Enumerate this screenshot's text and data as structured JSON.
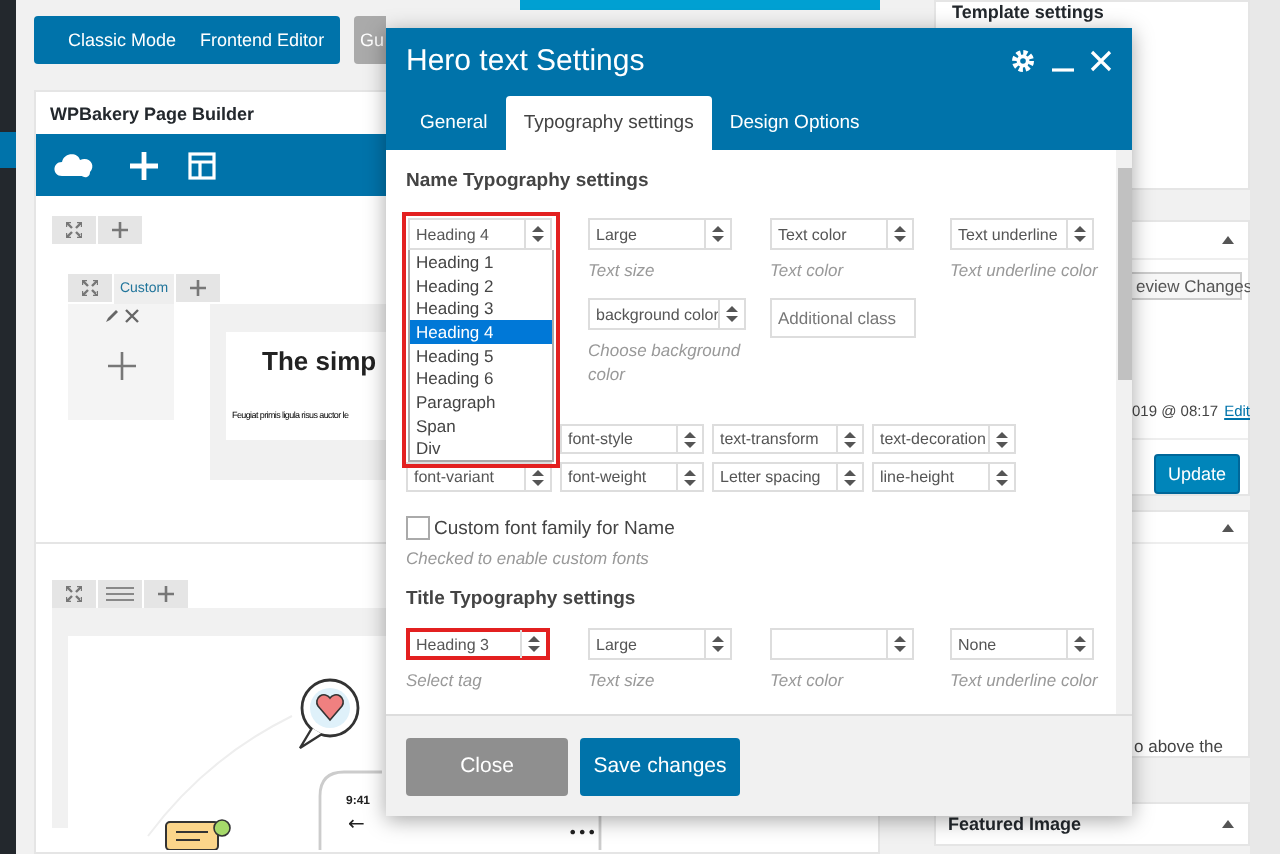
{
  "topbar": {
    "mode_buttons": [
      {
        "label": "Classic Mode"
      },
      {
        "label": "Frontend Editor"
      }
    ],
    "guide_button": "Gu"
  },
  "builder": {
    "title": "WPBakery Page Builder",
    "column_label": "Custom",
    "heading": "The simp",
    "paragraph": "Feugiat primis ligula risus auctor le",
    "phone_time": "9:41",
    "phone_back": "←",
    "phone_menu": "•••"
  },
  "sidebar": {
    "template_title": "Template settings",
    "preview_button": "eview Changes",
    "date": "019 @ 08:17",
    "edit_link": "Edit",
    "update_button": "Update",
    "note": "o above the",
    "featured_title": "Featured Image"
  },
  "modal": {
    "title": "Hero text Settings",
    "tabs": [
      {
        "label": "General",
        "selected": false
      },
      {
        "label": "Typography settings",
        "selected": true
      },
      {
        "label": "Design Options",
        "selected": false
      }
    ],
    "name_section": {
      "title": "Name Typography settings",
      "tag_select": {
        "value": "Heading 4",
        "highlighted": true,
        "open": true,
        "options": [
          {
            "label": "Heading 1",
            "selected": false
          },
          {
            "label": "Heading 2",
            "selected": false
          },
          {
            "label": "Heading 3",
            "selected": false
          },
          {
            "label": "Heading 4",
            "selected": true
          },
          {
            "label": "Heading 5",
            "selected": false
          },
          {
            "label": "Heading 6",
            "selected": false
          },
          {
            "label": "Paragraph",
            "selected": false
          },
          {
            "label": "Span",
            "selected": false
          },
          {
            "label": "Div",
            "selected": false
          }
        ]
      },
      "fields": [
        {
          "kind": "select",
          "value": "Large",
          "caption": "Text size"
        },
        {
          "kind": "select",
          "value": "Text color",
          "caption": "Text color"
        },
        {
          "kind": "select",
          "value": "Text underline",
          "caption": "Text underline color"
        },
        {
          "kind": "select",
          "value": "background color",
          "caption": "Choose background color"
        },
        {
          "kind": "input",
          "placeholder": "Additional class"
        }
      ],
      "style_rows": [
        [
          "font-style",
          "text-transform",
          "text-decoration"
        ],
        [
          "font-variant",
          "font-weight",
          "Letter spacing",
          "line-height"
        ]
      ],
      "custom_font": {
        "label": "Custom font family for Name",
        "checked": false,
        "caption": "Checked to enable custom fonts"
      }
    },
    "title_section": {
      "title": "Title Typography settings",
      "fields": [
        {
          "value": "Heading 3",
          "caption": "Select tag",
          "highlighted": true
        },
        {
          "value": "Large",
          "caption": "Text size",
          "highlighted": false
        },
        {
          "caption": "Text color",
          "highlighted": false
        },
        {
          "value": "None",
          "caption": "Text underline color",
          "highlighted": false
        }
      ]
    },
    "close_button": {
      "label": "Close",
      "disabled": true
    },
    "save_button": {
      "label": "Save changes"
    }
  }
}
